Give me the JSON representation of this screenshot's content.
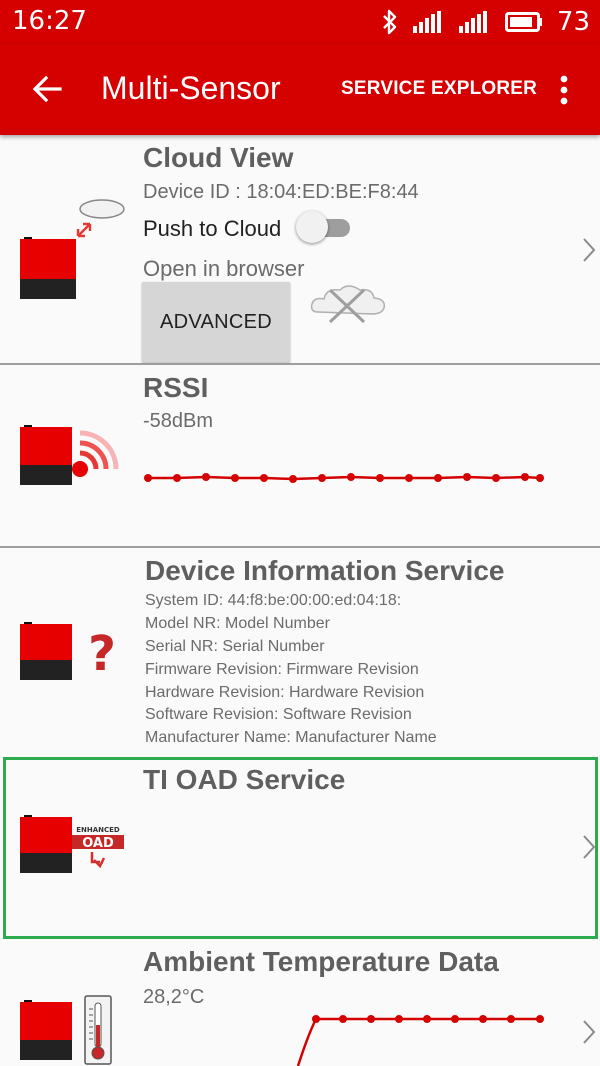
{
  "status_bar": {
    "time": "16:27",
    "battery_level": "73",
    "icons": [
      "bluetooth-icon",
      "signal-icon",
      "signal-icon",
      "battery-icon"
    ]
  },
  "app_bar": {
    "title": "Multi-Sensor",
    "action_label": "SERVICE EXPLORER",
    "icons": [
      "back-arrow-icon",
      "overflow-menu-icon"
    ]
  },
  "colors": {
    "accent": "#d50000",
    "highlight": "#2eaa4f",
    "chart_line": "#d50000"
  },
  "cloud_view": {
    "title": "Cloud View",
    "device_id": "Device ID : 18:04:ED:BE:F8:44",
    "push_label": "Push to Cloud",
    "push_enabled": false,
    "open_browser": "Open in browser",
    "advanced_label": "ADVANCED",
    "icons": [
      "sensor-tag-icon",
      "cloud-icon",
      "cloud-disconnected-icon",
      "chevron-right-icon"
    ]
  },
  "rssi": {
    "title": "RSSI",
    "value": "-58dBm",
    "icons": [
      "sensor-tag-icon",
      "wifi-signal-icon"
    ]
  },
  "device_info": {
    "title": "Device Information Service",
    "lines": [
      "System ID: 44:f8:be:00:00:ed:04:18:",
      "Model NR: Model Number",
      "Serial NR: Serial Number",
      "Firmware Revision: Firmware Revision",
      "Hardware Revision: Hardware Revision",
      "Software Revision: Software Revision",
      "Manufacturer Name: Manufacturer Name"
    ],
    "icons": [
      "sensor-tag-icon",
      "question-mark-icon"
    ]
  },
  "oad": {
    "title": "TI OAD Service",
    "badge_top": "ENHANCED",
    "badge_bottom": "OAD",
    "icons": [
      "sensor-tag-icon",
      "oad-download-icon",
      "chevron-right-icon"
    ]
  },
  "ambient": {
    "title": "Ambient Temperature Data",
    "value": "28,2°C",
    "icons": [
      "sensor-tag-icon",
      "thermometer-icon",
      "chevron-right-icon"
    ]
  }
}
